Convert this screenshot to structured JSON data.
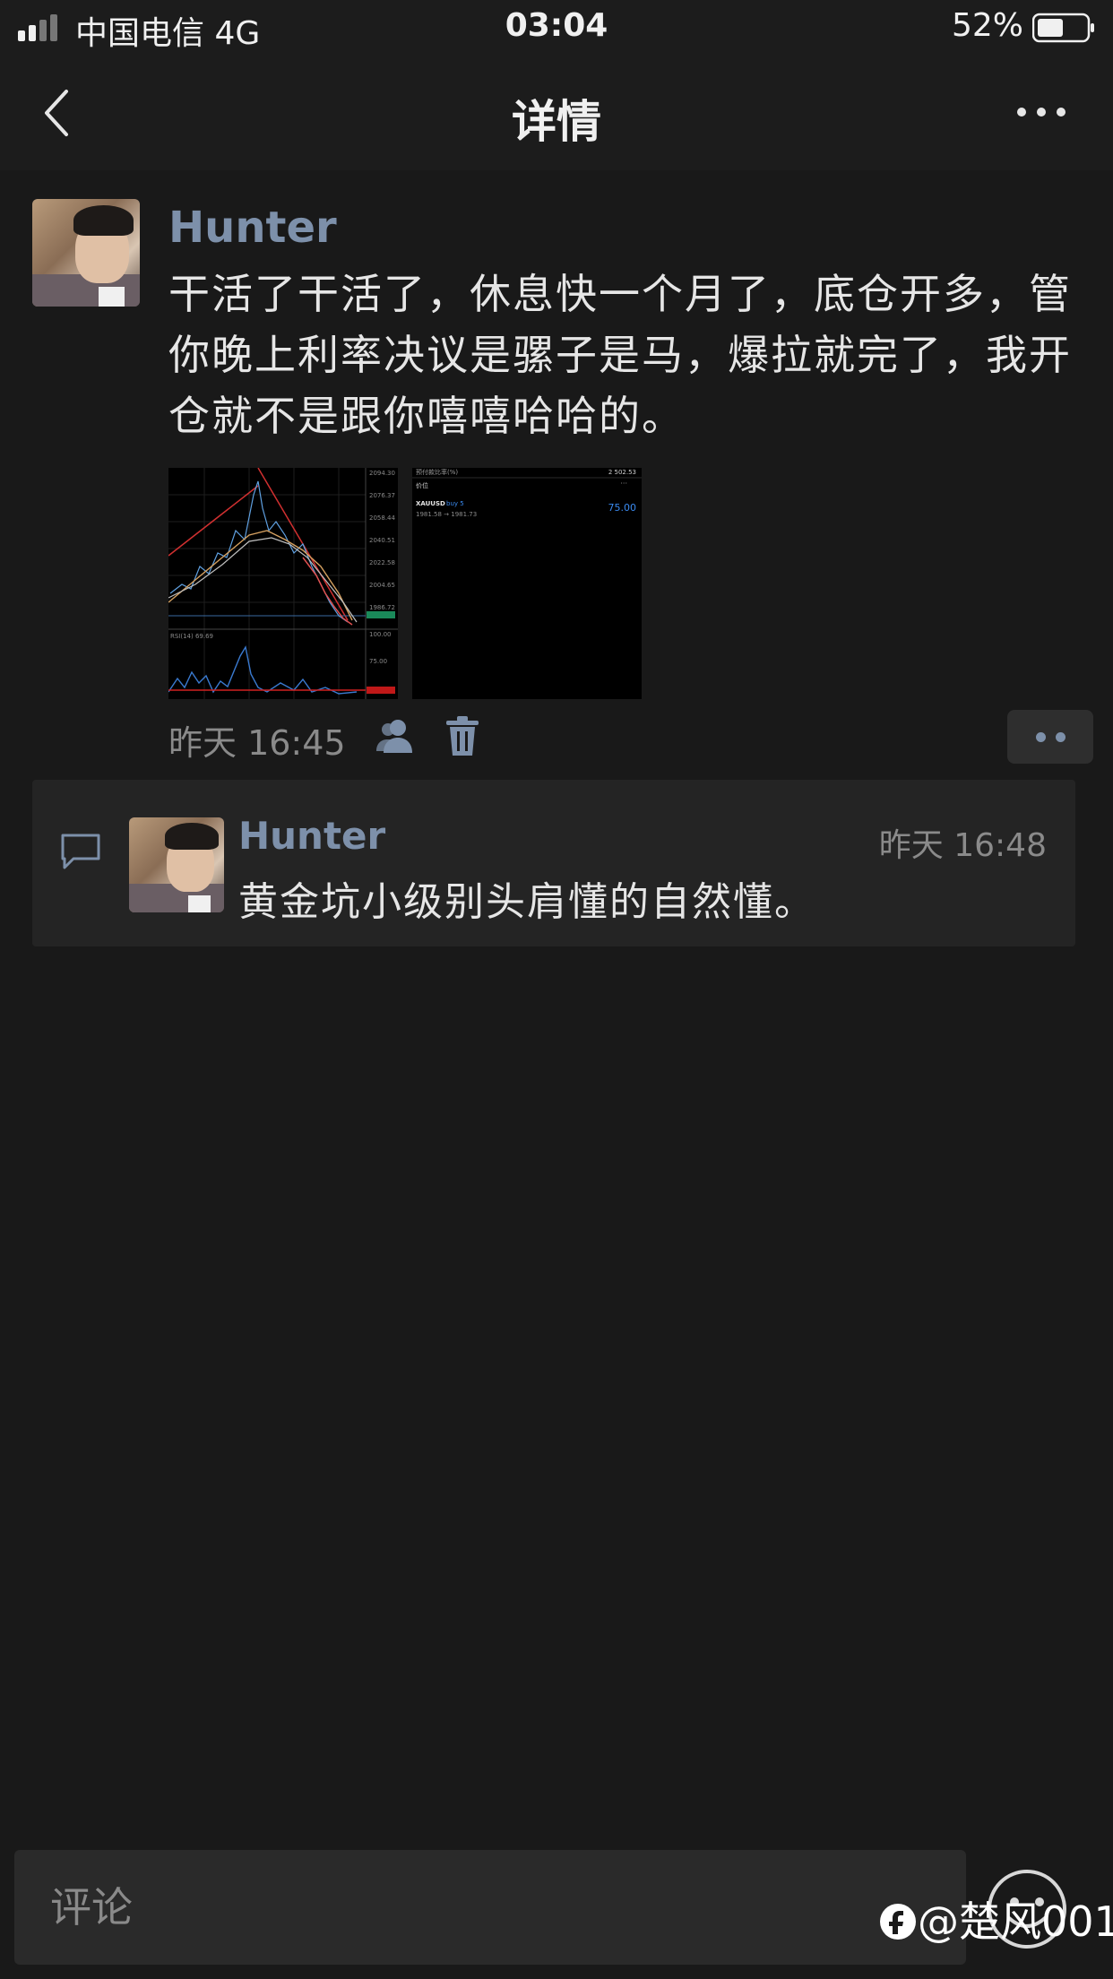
{
  "status_bar": {
    "carrier": "中国电信   4G",
    "time": "03:04",
    "battery": "52%"
  },
  "nav": {
    "title": "详情",
    "back_icon": "chevron-left-icon",
    "more_icon": "ellipsis-icon"
  },
  "post": {
    "author": "Hunter",
    "text": "干活了干活了，休息快一个月了，底仓开多，管你晚上利率决议是骡子是马，爆拉就完了，我开仓就不是跟你嘻嘻哈哈的。",
    "time": "昨天 16:45",
    "images": [
      {
        "kind": "trading-chart",
        "price_labels": [
          "2094.30",
          "2076.37",
          "2058.44",
          "2040.51",
          "2022.58",
          "2004.65",
          "1986.72",
          "100.00",
          "75.00"
        ],
        "indicator_label": "RSI(14) 69.69"
      },
      {
        "kind": "trade-list",
        "header_left": "预付款比率(%)",
        "header_right": "2 502.53",
        "section_label": "价位",
        "symbol": "XAUUSD",
        "side": "buy 5",
        "prices": "1981.58 → 1981.73",
        "profit": "75.00"
      }
    ]
  },
  "comments": [
    {
      "author": "Hunter",
      "time": "昨天 16:48",
      "text": "黄金坑小级别头肩懂的自然懂。"
    }
  ],
  "input": {
    "placeholder": "评论"
  },
  "watermark": {
    "text": "@楚风001"
  },
  "colors": {
    "background": "#191919",
    "name_link": "#7d90aa",
    "secondary_text": "#8a8a8a"
  }
}
